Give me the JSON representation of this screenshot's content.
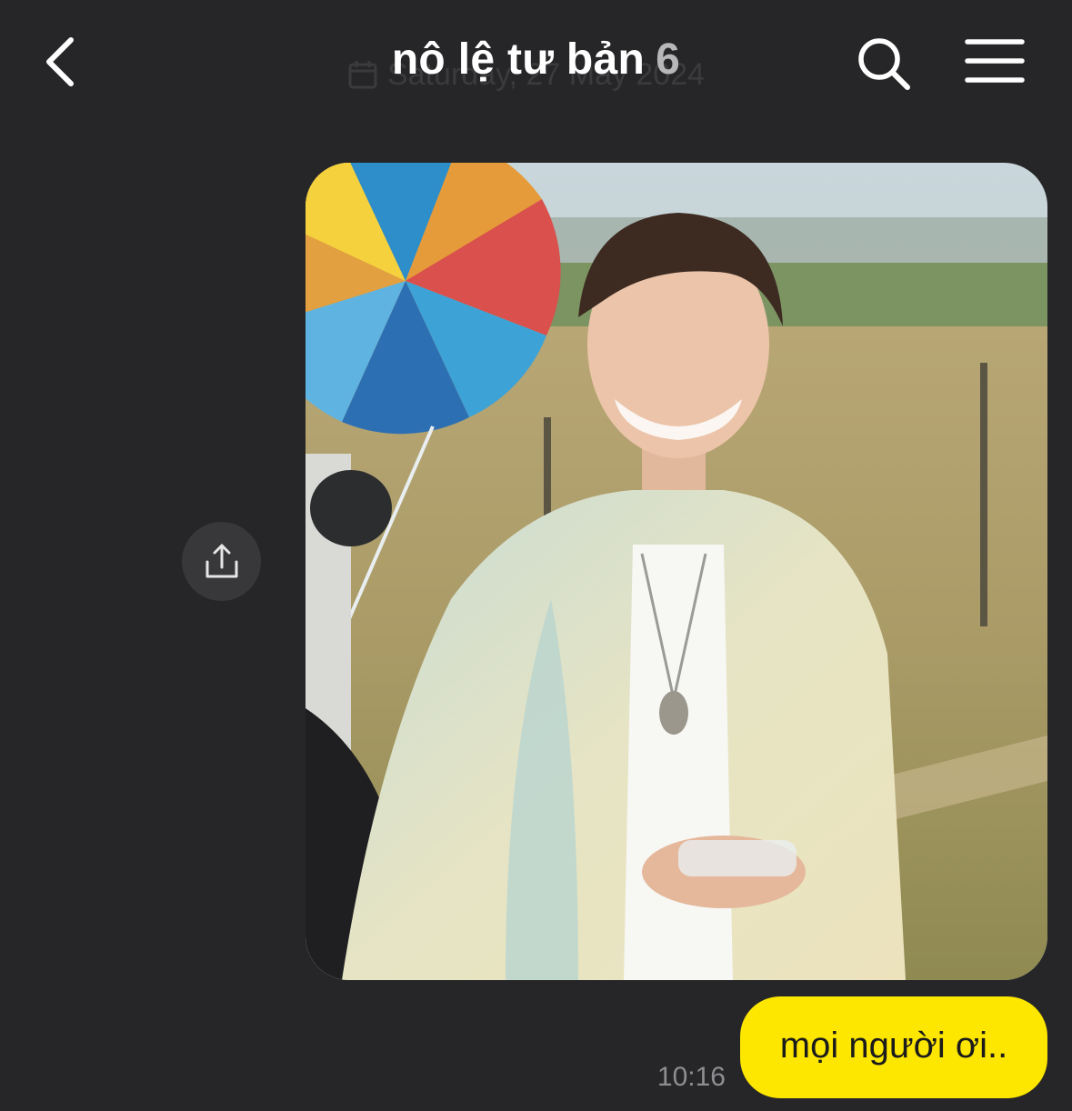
{
  "header": {
    "title": "nô lệ tư bản",
    "member_count": "6",
    "date_ghost": "Saturday, 27 May 2024",
    "back_icon": "chevron-left-icon",
    "search_icon": "search-icon",
    "menu_icon": "hamburger-menu-icon"
  },
  "messages": [
    {
      "type": "image",
      "description_icon": "photo",
      "share_icon": "share-upload-icon"
    },
    {
      "type": "text",
      "text": "mọi người ơi..",
      "time": "10:16"
    }
  ],
  "colors": {
    "background": "#262628",
    "bubble": "#fde600",
    "share_button": "#38383b"
  }
}
